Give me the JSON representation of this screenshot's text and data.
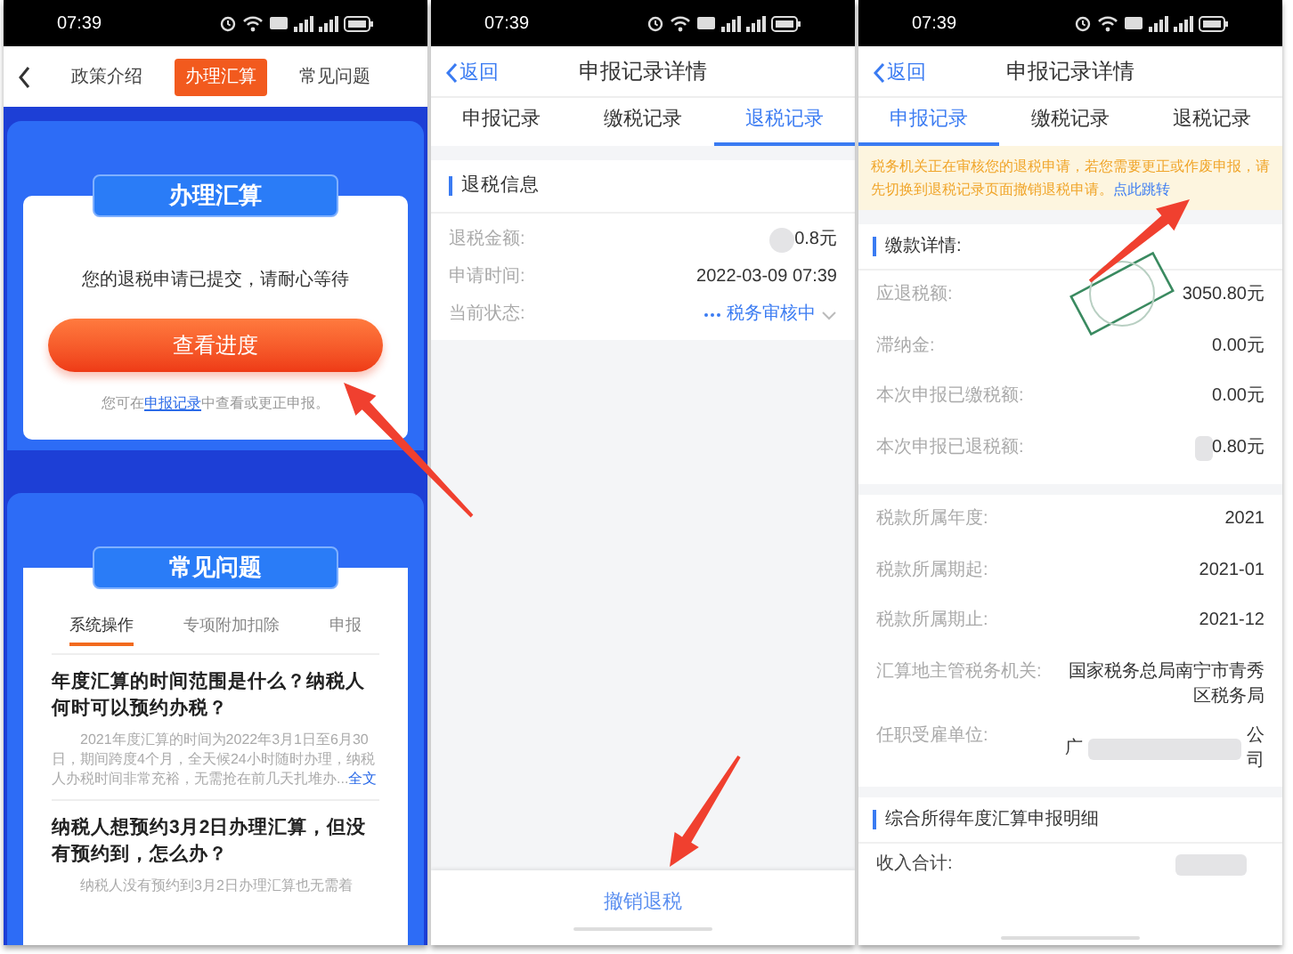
{
  "screen_1": {
    "status_time": "07:39",
    "tabs": [
      {
        "label": "政策介绍",
        "selected": false
      },
      {
        "label": "办理汇算",
        "selected": true
      },
      {
        "label": "常见问题",
        "selected": false
      }
    ],
    "process_card": {
      "title": "办理汇算",
      "message": "您的退税申请已提交，请耐心等待",
      "button": "查看进度",
      "note_before": "您可在",
      "note_link": "申报记录",
      "note_after": "中查看或更正申报。"
    },
    "faq_card": {
      "title": "常见问题",
      "tabs": [
        {
          "label": "系统操作",
          "selected": true
        },
        {
          "label": "专项附加扣除",
          "selected": false
        },
        {
          "label": "申报",
          "selected": false
        }
      ],
      "questions": [
        {
          "title": "年度汇算的时间范围是什么？纳税人何时可以预约办税？",
          "summary": "2021年度汇算的时间为2022年3月1日至6月30日，期间跨度4个月，全天候24小时随时办理，纳税人办税时间非常充裕，无需抢在前几天扎堆办...",
          "more": "全文"
        },
        {
          "title": "纳税人想预约3月2日办理汇算，但没有预约到，怎么办？",
          "summary": "纳税人没有预约到3月2日办理汇算也无需着"
        }
      ]
    }
  },
  "screen_2": {
    "status_time": "07:39",
    "back": "返回",
    "title": "申报记录详情",
    "tabs": [
      {
        "label": "申报记录",
        "selected": false
      },
      {
        "label": "缴税记录",
        "selected": false
      },
      {
        "label": "退税记录",
        "selected": true
      }
    ],
    "section_title": "退税信息",
    "rows": [
      {
        "kind": "text",
        "label": "退税金额:",
        "value": "0.8元",
        "blurred": true
      },
      {
        "kind": "text",
        "label": "申请时间:",
        "value": "2022-03-09 07:39",
        "blurred": false
      },
      {
        "kind": "status",
        "label": "当前状态:",
        "value": "税务审核中",
        "blurred": false
      }
    ],
    "bottom_button": "撤销退税"
  },
  "screen_3": {
    "status_time": "07:39",
    "back": "返回",
    "title": "申报记录详情",
    "tabs": [
      {
        "label": "申报记录",
        "selected": true
      },
      {
        "label": "缴税记录",
        "selected": false
      },
      {
        "label": "退税记录",
        "selected": false
      }
    ],
    "notice": {
      "text": "税务机关正在审核您的退税申请，若您需要更正或作废申报，请先切换到退税记录页面撤销退税申请。",
      "link": "点此跳转"
    },
    "section_title": "缴款详情:",
    "groups": [
      [
        {
          "label": "应退税额:",
          "value": "3050.80元",
          "blurred": false,
          "stamped": true
        },
        {
          "label": "滞纳金:",
          "value": "0.00元",
          "blurred": false,
          "stamped": false
        },
        {
          "label": "本次申报已缴税额:",
          "value": "0.00元",
          "blurred": false,
          "stamped": false
        },
        {
          "label": "本次申报已退税额:",
          "value": "0.80元",
          "blurred": true,
          "stamped": false
        }
      ],
      [
        {
          "label": "税款所属年度:",
          "value": "2021",
          "blurred": false,
          "stamped": false
        },
        {
          "label": "税款所属期起:",
          "value": "2021-01",
          "blurred": false,
          "stamped": false
        },
        {
          "label": "税款所属期止:",
          "value": "2021-12",
          "blurred": false,
          "stamped": false
        },
        {
          "label": "汇算地主管税务机关:",
          "value": "国家税务总局南宁市青秀区税务局",
          "blurred": false,
          "stamped": false
        },
        {
          "label": "任职受雇单位:",
          "value": "广",
          "value_end": "公司",
          "blurred": true,
          "stamped": false
        }
      ]
    ],
    "section_2_title": "综合所得年度汇算申报明细",
    "rows_2": [
      {
        "label": "收入合计:",
        "blurred": true
      }
    ]
  }
}
